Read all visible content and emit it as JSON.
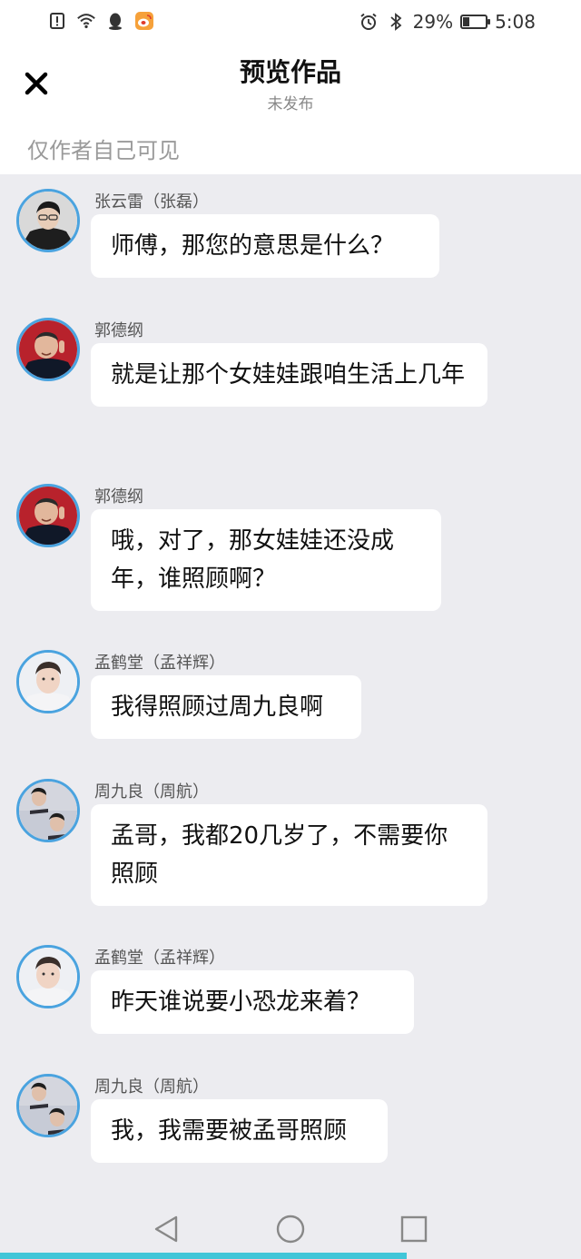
{
  "status_bar": {
    "battery_percent": "29%",
    "battery_level": 0.29,
    "time": "5:08",
    "icons": [
      "alert-icon",
      "wifi-icon",
      "qq-icon",
      "weibo-icon",
      "alarm-icon",
      "bluetooth-icon",
      "battery-icon"
    ]
  },
  "header": {
    "title": "预览作品",
    "subtitle": "未发布",
    "privacy_note": "仅作者自己可见"
  },
  "messages": [
    {
      "name": "张云雷（张磊）",
      "text": "师傅，那您的意思是什么？",
      "avatar": "avatar-zhangyunlei"
    },
    {
      "name": "郭德纲",
      "text": "就是让那个女娃娃跟咱生活上几年",
      "avatar": "avatar-guodegang"
    },
    {
      "name": "郭德纲",
      "text": "哦，对了，那女娃娃还没成年，谁照顾啊？",
      "avatar": "avatar-guodegang"
    },
    {
      "name": "孟鹤堂（孟祥辉）",
      "text": "我得照顾过周九良啊",
      "avatar": "avatar-menghetang"
    },
    {
      "name": "周九良（周航）",
      "text": "孟哥，我都20几岁了，不需要你照顾",
      "avatar": "avatar-zhoujiuliang"
    },
    {
      "name": "孟鹤堂（孟祥辉）",
      "text": "昨天谁说要小恐龙来着？",
      "avatar": "avatar-menghetang"
    },
    {
      "name": "周九良（周航）",
      "text": "我，我需要被孟哥照顾",
      "avatar": "avatar-zhoujiuliang"
    }
  ],
  "nav": {
    "icons": [
      "back-triangle-icon",
      "home-circle-icon",
      "recents-square-icon"
    ]
  },
  "progress": {
    "fraction": 0.7
  },
  "colors": {
    "accent_blue": "#4aa3df",
    "progress_teal": "#41c6d8",
    "background": "#ececf0"
  }
}
